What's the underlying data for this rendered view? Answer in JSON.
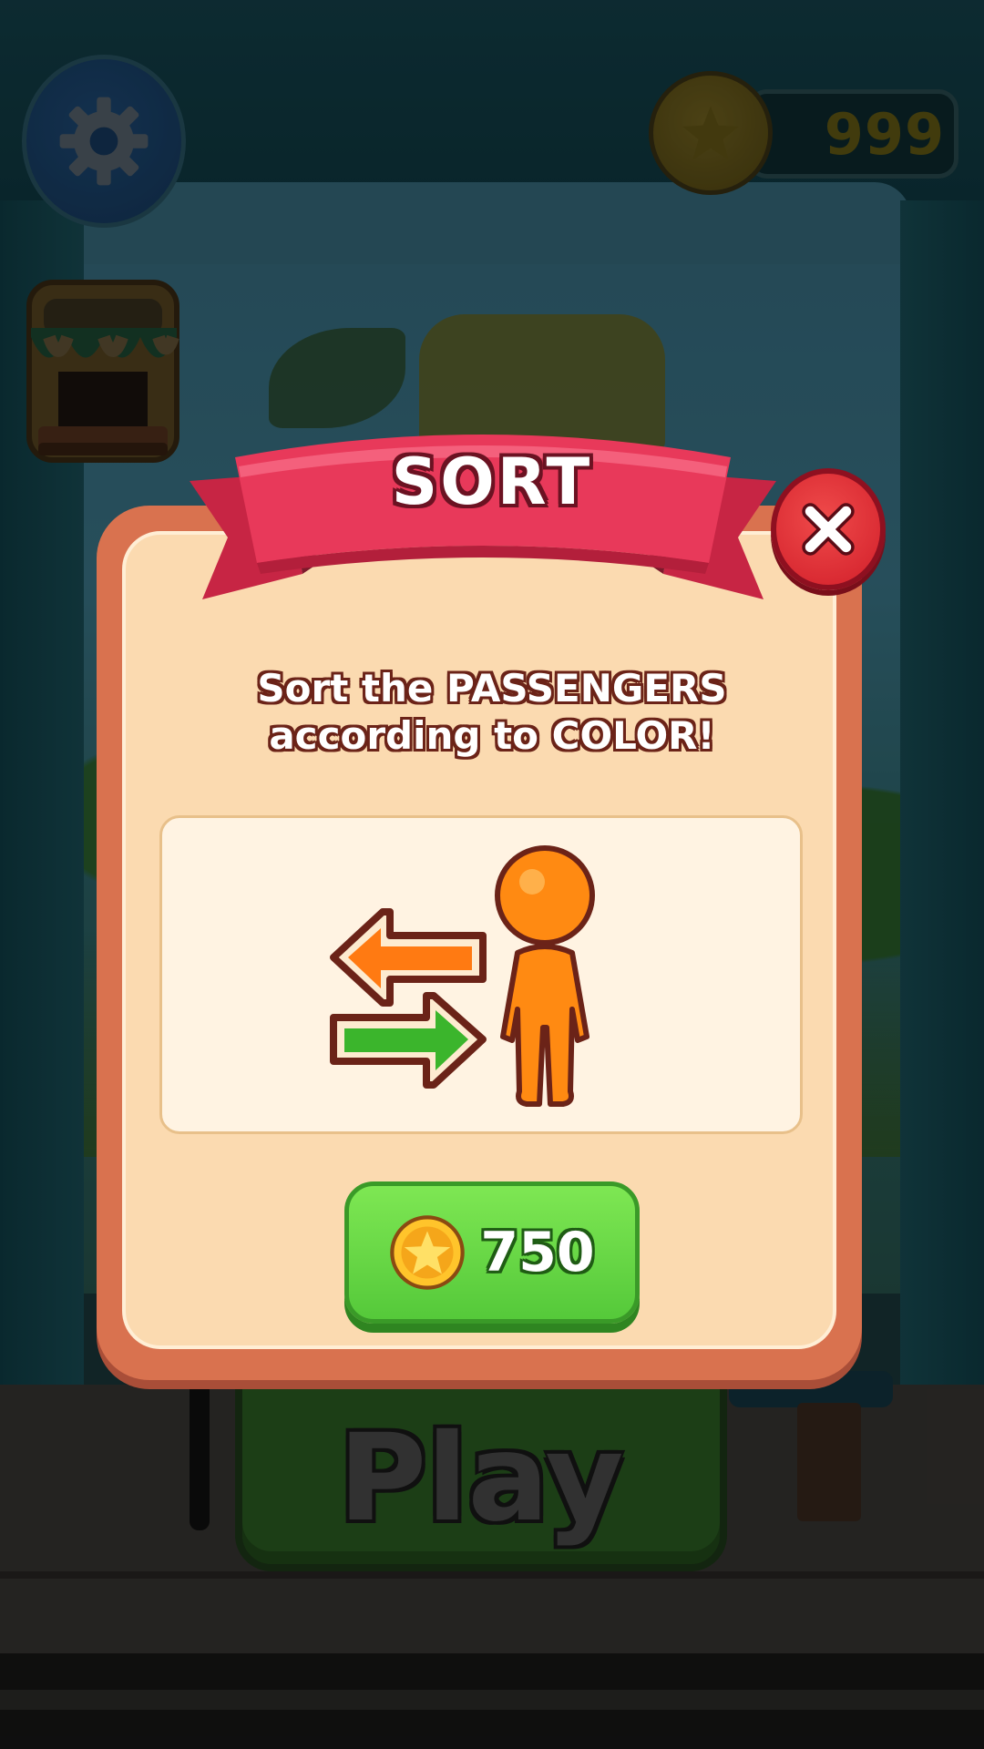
{
  "hud": {
    "coins": "999",
    "settings_icon": "gear-icon",
    "coin_icon": "star-coin-icon",
    "shop_icon": "shop-stall-icon"
  },
  "play_button": {
    "label": "Play"
  },
  "modal": {
    "title": "SORT",
    "description_line1": "Sort the PASSENGERS",
    "description_line2": "according to COLOR!",
    "illustration": {
      "icons": [
        "swap-arrows-icon",
        "passenger-figure-icon"
      ]
    },
    "buy_button": {
      "price": "750",
      "icon": "star-coin-icon"
    },
    "close_icon": "close-icon"
  },
  "colors": {
    "ribbon": "#e8395a",
    "panel": "#fbdab0",
    "panel_border": "#d9724f",
    "buy_button": "#6fdc47",
    "close_button": "#e0333a",
    "passenger": "#ff8a12"
  }
}
